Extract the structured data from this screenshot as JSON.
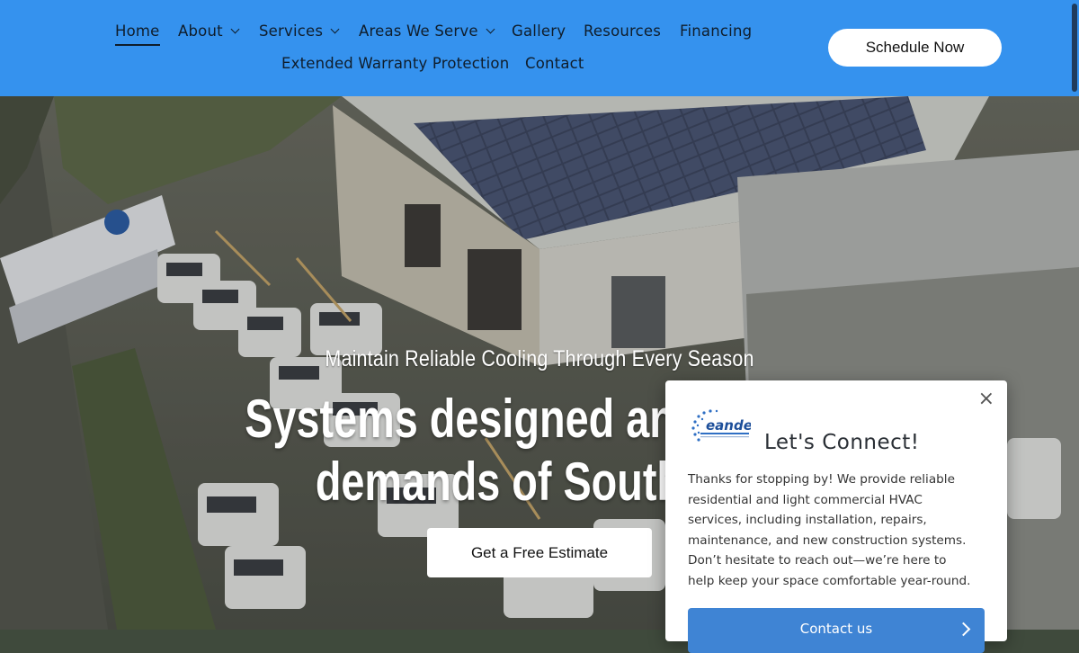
{
  "nav": {
    "items": [
      {
        "label": "Home",
        "active": true
      },
      {
        "label": "About",
        "dropdown": true
      },
      {
        "label": "Services",
        "dropdown": true
      },
      {
        "label": "Areas We Serve",
        "dropdown": true
      },
      {
        "label": "Gallery"
      },
      {
        "label": "Resources"
      },
      {
        "label": "Financing"
      },
      {
        "label": "Extended Warranty Protection"
      },
      {
        "label": "Contact"
      }
    ],
    "cta_label": "Schedule Now"
  },
  "hero": {
    "subtitle": "Maintain Reliable Cooling Through Every Season",
    "title_line1": "Systems designed and servic",
    "title_line2": "demands of South Tex",
    "button_label": "Get a Free Estimate"
  },
  "popup": {
    "logo_text": "eande",
    "title": "Let's Connect!",
    "body": "Thanks for stopping by! We provide reliable residential and light commercial HVAC services, including installation, repairs, maintenance, and new construction systems. Don’t hesitate to reach out—we’re here to help keep your space comfortable year-round.",
    "button_label": "Contact us",
    "close_symbol": "×"
  },
  "colors": {
    "header_bg": "#3592ee",
    "nav_text": "#0f1d2b",
    "popup_button": "#3f84d4"
  },
  "icons": [
    "chevron-down-icon",
    "close-icon",
    "chevron-right-icon",
    "company-logo"
  ]
}
